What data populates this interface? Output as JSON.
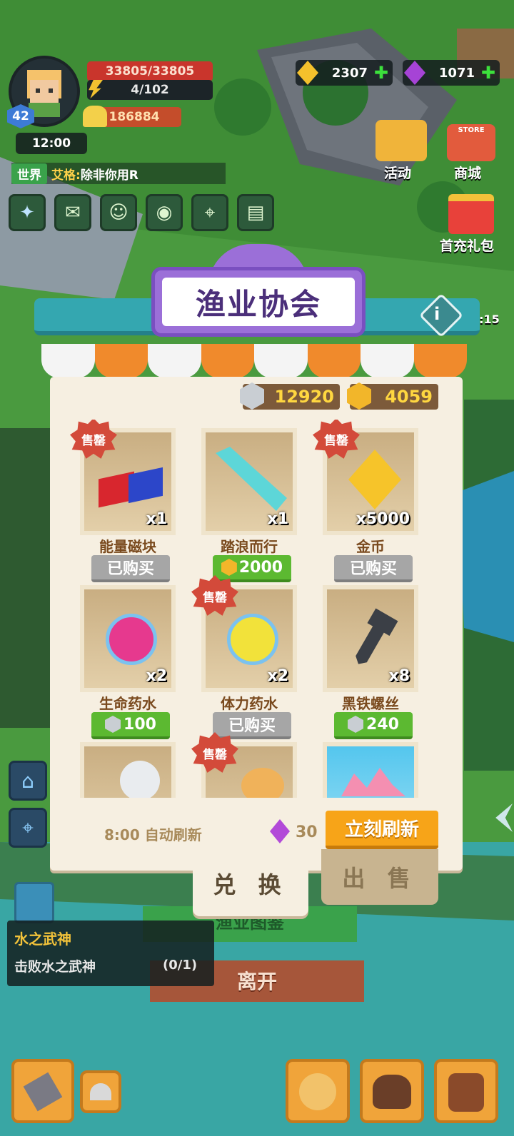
{
  "hud": {
    "hp": "33805/33805",
    "energy": "4/102",
    "power": "186884",
    "level": "42",
    "time": "12:00",
    "gold": "2307",
    "gems": "1071",
    "chat_channel": "世界",
    "chat_user": "艾格:",
    "chat_text": "除非你用R"
  },
  "side": {
    "event_label": "活动",
    "store_tag": "STORE",
    "store_label": "商城",
    "first_recharge_label": "首充礼包",
    "timer_fragment": "3:15"
  },
  "panel": {
    "title": "渔业协会",
    "silver_tokens": "12920",
    "gold_tokens": "4059",
    "auto_refresh": "8:00 自动刷新",
    "refresh_cost": "30",
    "refresh_button": "立刻刷新",
    "tab_exchange": "兑 换",
    "tab_sell": "出 售"
  },
  "items": [
    {
      "name": "能量磁块",
      "qty": "x1",
      "price": "已购买",
      "state": "sold",
      "sale": "售罄"
    },
    {
      "name": "踏浪而行",
      "qty": "x1",
      "price": "2000",
      "state": "gold",
      "sale": ""
    },
    {
      "name": "金币",
      "qty": "x5000",
      "price": "已购买",
      "state": "sold",
      "sale": "售罄"
    },
    {
      "name": "生命药水",
      "qty": "x2",
      "price": "100",
      "state": "silver",
      "sale": ""
    },
    {
      "name": "体力药水",
      "qty": "x2",
      "price": "已购买",
      "state": "sold",
      "sale": "售罄"
    },
    {
      "name": "黑铁螺丝",
      "qty": "x8",
      "price": "240",
      "state": "silver",
      "sale": ""
    },
    {
      "name": "",
      "qty": "",
      "price": "",
      "state": "hidden",
      "sale": ""
    },
    {
      "name": "",
      "qty": "",
      "price": "",
      "state": "hidden",
      "sale": "售罄"
    },
    {
      "name": "",
      "qty": "",
      "price": "",
      "state": "hidden",
      "sale": ""
    }
  ],
  "quest": {
    "title": "水之武神",
    "desc": "击败水之武神",
    "progress_fragment": "(0/1)"
  },
  "behind": {
    "guide_button": "渔业图鉴",
    "leave_button": "离开"
  },
  "colors": {
    "panel_bg": "#f6efe1",
    "awning_orange": "#f08a2c",
    "title_purple": "#9b6fd8",
    "buy_green": "#5cb931",
    "sold_gray": "#a6a6a6",
    "refresh_orange": "#f7a418"
  }
}
